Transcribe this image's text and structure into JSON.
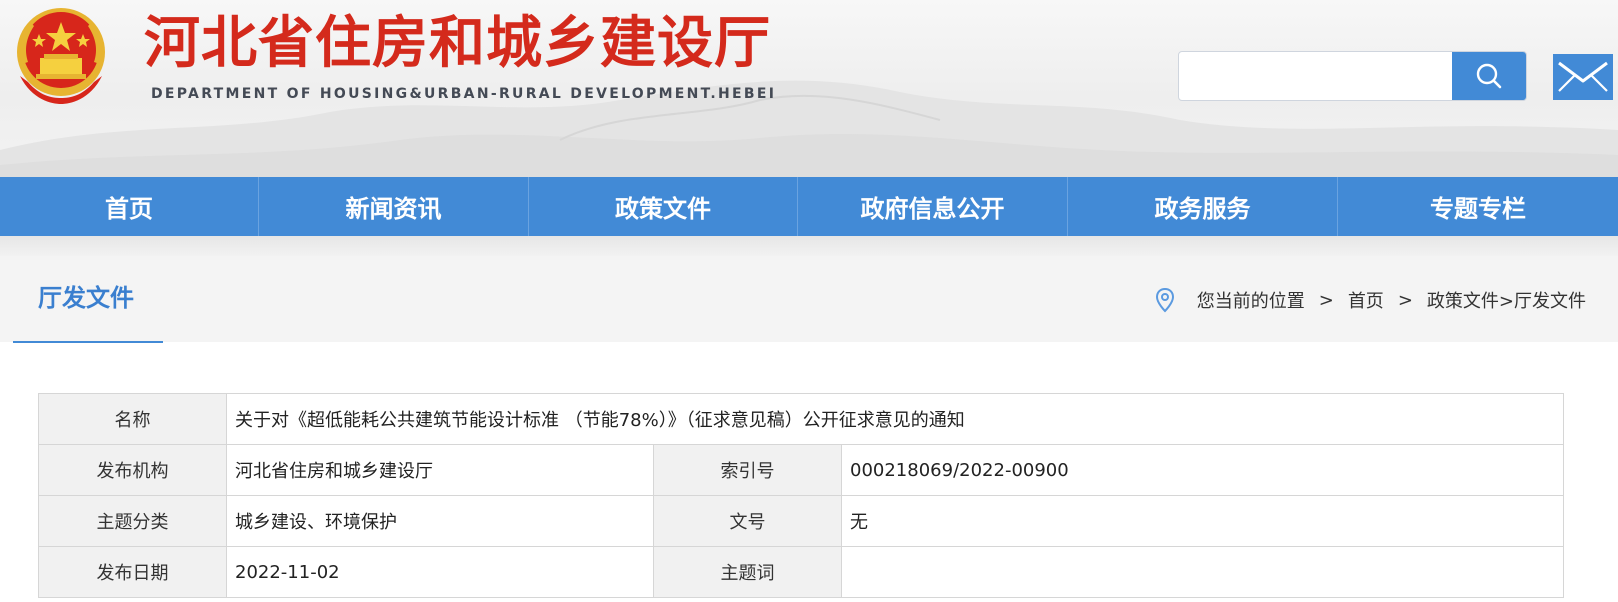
{
  "header": {
    "title": "河北省住房和城乡建设厅",
    "subtitle": "DEPARTMENT OF HOUSING&URBAN-RURAL DEVELOPMENT.HEBEI",
    "search": {
      "value": "",
      "placeholder": ""
    },
    "search_icon": "search-icon",
    "mail_icon": "mail-icon",
    "colors": {
      "brand_red": "#d42a1c",
      "accent_blue": "#428ad6"
    }
  },
  "nav": {
    "items": [
      {
        "label": "首页"
      },
      {
        "label": "新闻资讯"
      },
      {
        "label": "政策文件"
      },
      {
        "label": "政府信息公开"
      },
      {
        "label": "政务服务"
      },
      {
        "label": "专题专栏"
      }
    ]
  },
  "section": {
    "title": "厅发文件"
  },
  "breadcrumb": {
    "location_icon": "location-pin-icon",
    "prefix": "您当前的位置",
    "sep1": ">",
    "home": "首页",
    "sep2": ">",
    "path": "政策文件>厅发文件"
  },
  "info": {
    "name_label": "名称",
    "name_value": "关于对《超低能耗公共建筑节能设计标准 （节能78%）》（征求意见稿）公开征求意见的通知",
    "publisher_label": "发布机构",
    "publisher_value": "河北省住房和城乡建设厅",
    "index_label": "索引号",
    "index_value": "000218069/2022-00900",
    "category_label": "主题分类",
    "category_value": "城乡建设、环境保护",
    "docno_label": "文号",
    "docno_value": "无",
    "date_label": "发布日期",
    "date_value": "2022-11-02",
    "keywords_label": "主题词",
    "keywords_value": ""
  }
}
